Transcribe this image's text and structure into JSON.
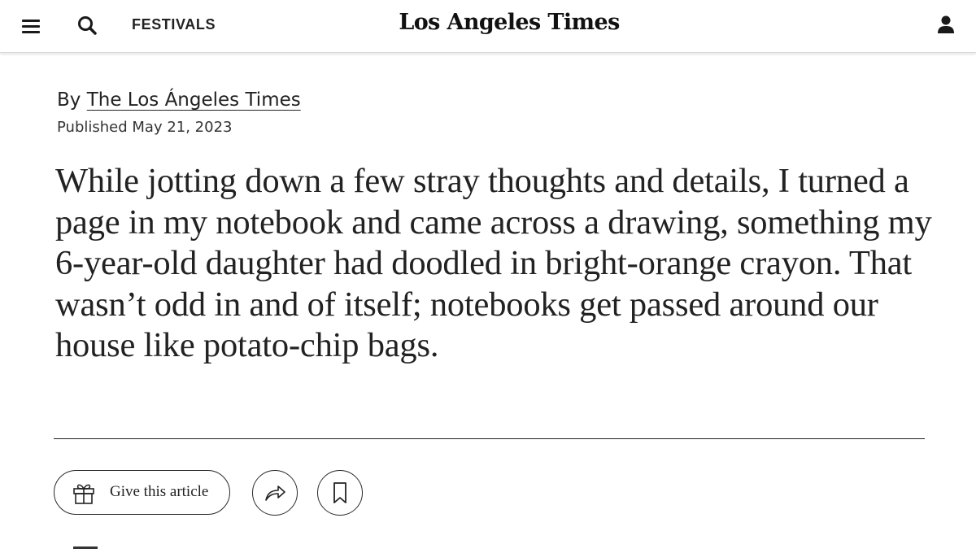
{
  "header": {
    "menu_icon": "hamburger-menu-icon",
    "search_icon": "search-icon",
    "nav_label": "FESTIVALS",
    "brand": "Los Angeles Times",
    "account_icon": "user-account-icon"
  },
  "article": {
    "byline_prefix": "By",
    "byline_author": "The Los Ángeles Times",
    "published": "Published May 21, 2023",
    "lede": "While jotting down a few stray thoughts and details, I turned a page in my notebook and came across a drawing, something my 6-year-old daughter had doodled in bright-orange crayon. That wasn’t odd in and of itself; notebooks get passed around our house like potato-chip bags."
  },
  "actions": {
    "gift_label": "Give this article",
    "gift_icon": "gift-icon",
    "share_icon": "share-arrow-icon",
    "bookmark_icon": "bookmark-icon"
  },
  "colors": {
    "text": "#1a1a1a",
    "divider": "#222222",
    "border": "#2a2a2a",
    "background": "#ffffff"
  }
}
